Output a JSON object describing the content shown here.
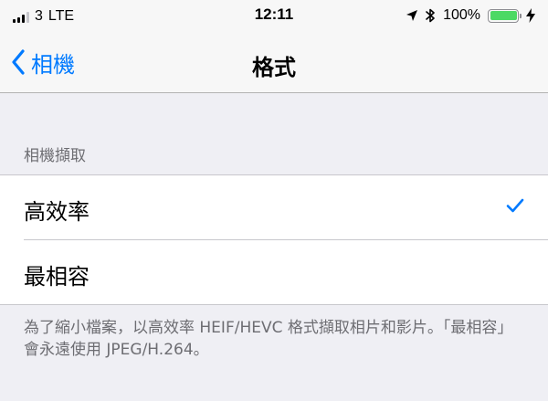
{
  "status_bar": {
    "carrier": "3",
    "network": "LTE",
    "time": "12:11",
    "battery_percent": "100%",
    "battery_level": 1.0
  },
  "nav": {
    "back_label": "相機",
    "title": "格式"
  },
  "section": {
    "header": "相機擷取",
    "options": [
      {
        "label": "高效率",
        "selected": true
      },
      {
        "label": "最相容",
        "selected": false
      }
    ]
  },
  "footer": {
    "note": "為了縮小檔案，以高效率 HEIF/HEVC 格式擷取相片和影片。「最相容」會永遠使用 JPEG/H.264。"
  },
  "colors": {
    "accent": "#007aff",
    "battery": "#4cd964",
    "background": "#efeff4"
  }
}
